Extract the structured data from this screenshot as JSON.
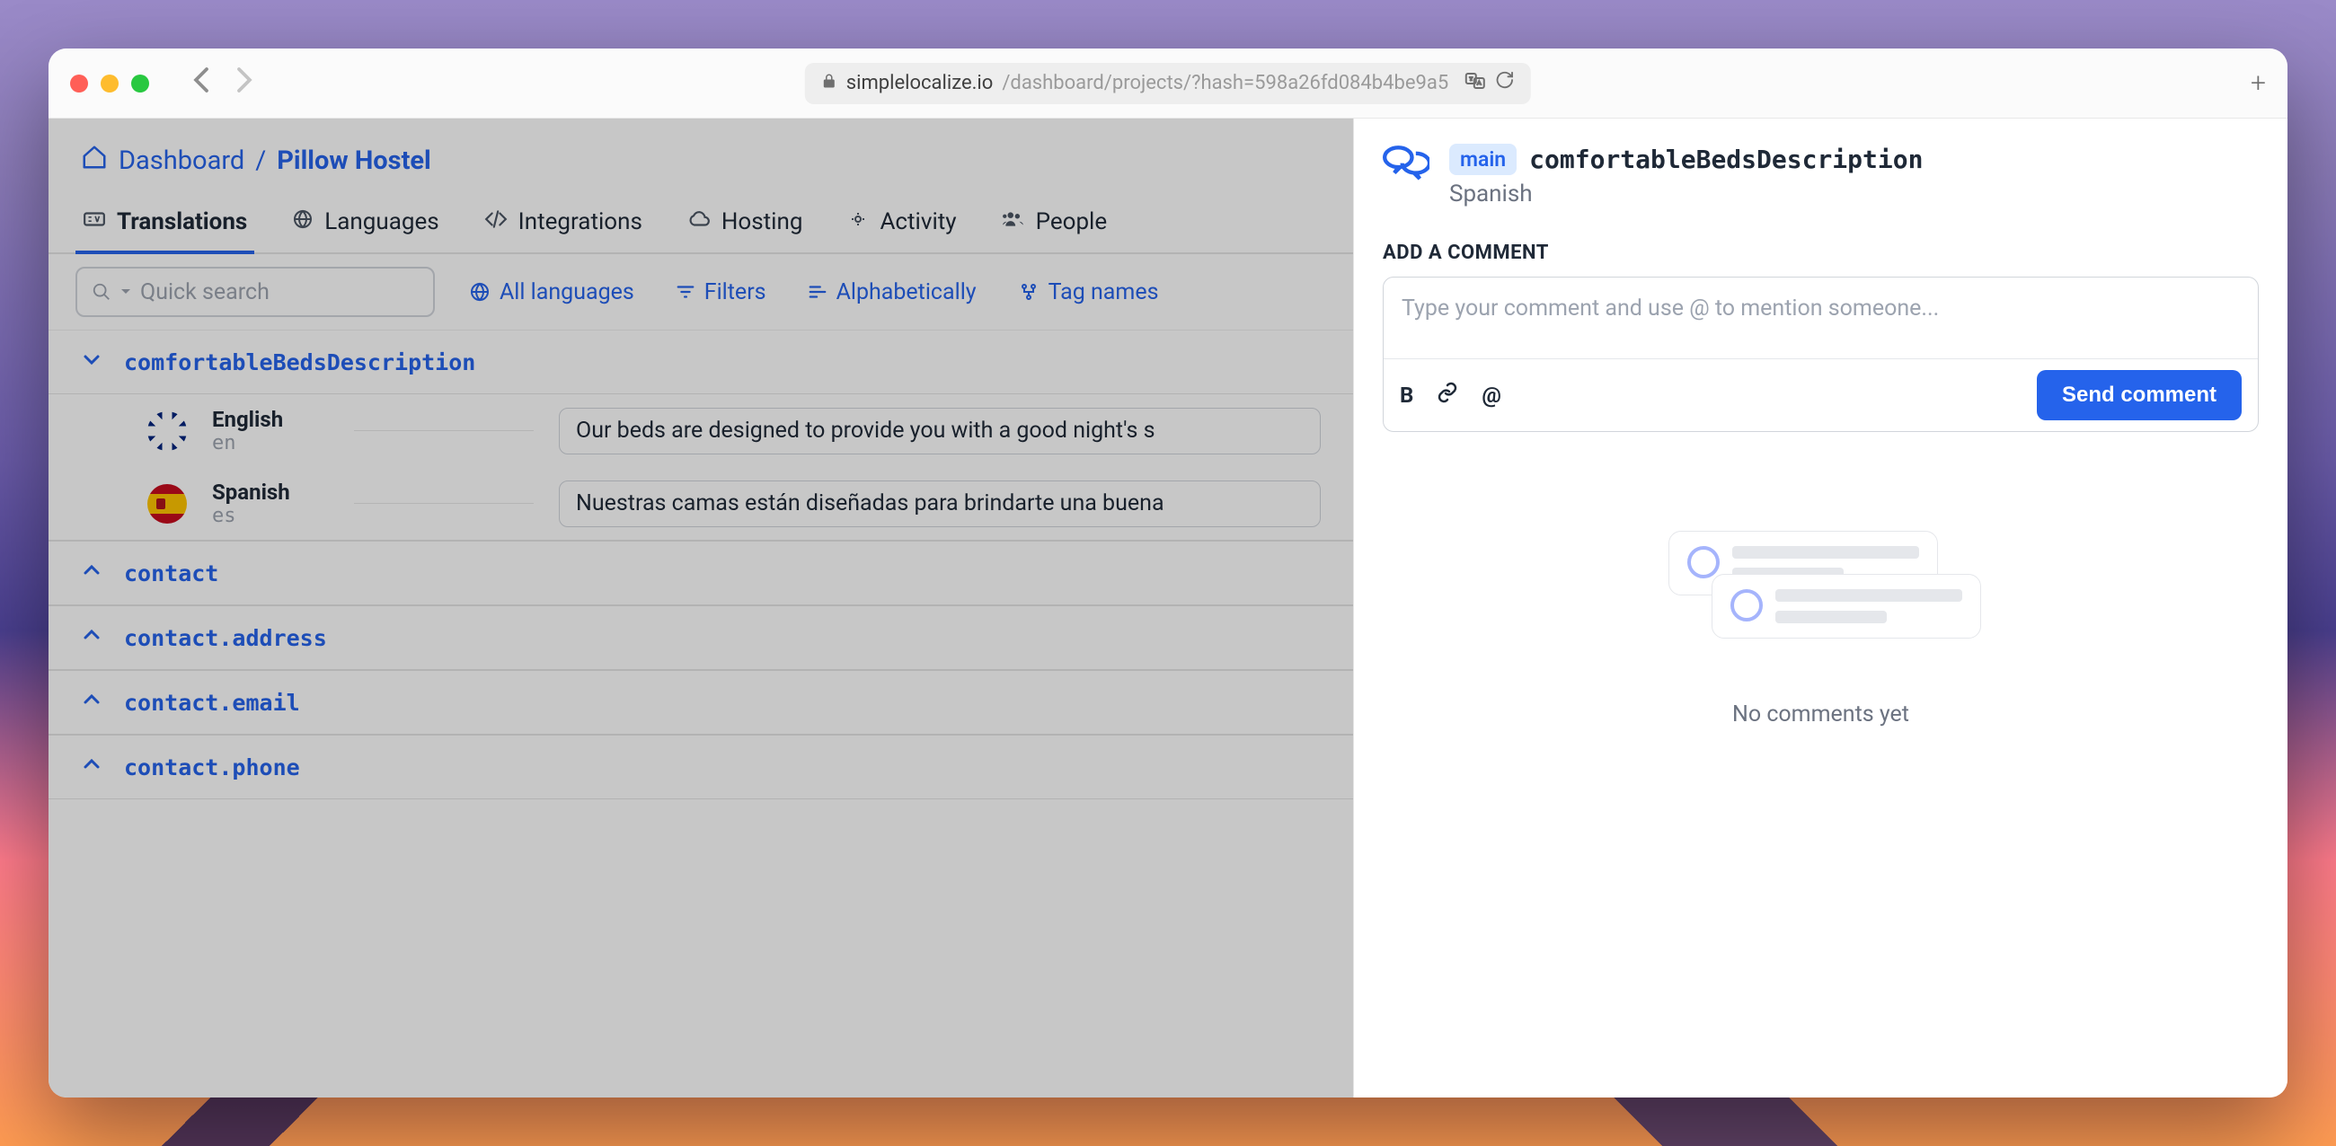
{
  "browser": {
    "url_domain": "simplelocalize.io",
    "url_path": "/dashboard/projects/?hash=598a26fd084b4be9a5"
  },
  "breadcrumb": {
    "dashboard": "Dashboard",
    "sep": "/",
    "project": "Pillow Hostel"
  },
  "tabs": {
    "translations": "Translations",
    "languages": "Languages",
    "integrations": "Integrations",
    "hosting": "Hosting",
    "activity": "Activity",
    "people": "People"
  },
  "toolbar": {
    "search_placeholder": "Quick search",
    "all_languages": "All languages",
    "filters": "Filters",
    "alphabetically": "Alphabetically",
    "tag_names": "Tag names"
  },
  "keys": {
    "expanded_key": "comfortableBedsDescription",
    "items": [
      {
        "lang_name": "English",
        "lang_code": "en",
        "value": "Our beds are designed to provide you with a good night's s"
      },
      {
        "lang_name": "Spanish",
        "lang_code": "es",
        "value": "Nuestras camas están diseñadas para brindarte una buena"
      }
    ],
    "collapsed": [
      "contact",
      "contact.address",
      "contact.email",
      "contact.phone"
    ]
  },
  "sidebar": {
    "branch": "main",
    "key": "comfortableBedsDescription",
    "language": "Spanish",
    "add_comment_label": "ADD A COMMENT",
    "placeholder": "Type your comment and use @ to mention someone...",
    "send": "Send comment",
    "empty": "No comments yet"
  }
}
